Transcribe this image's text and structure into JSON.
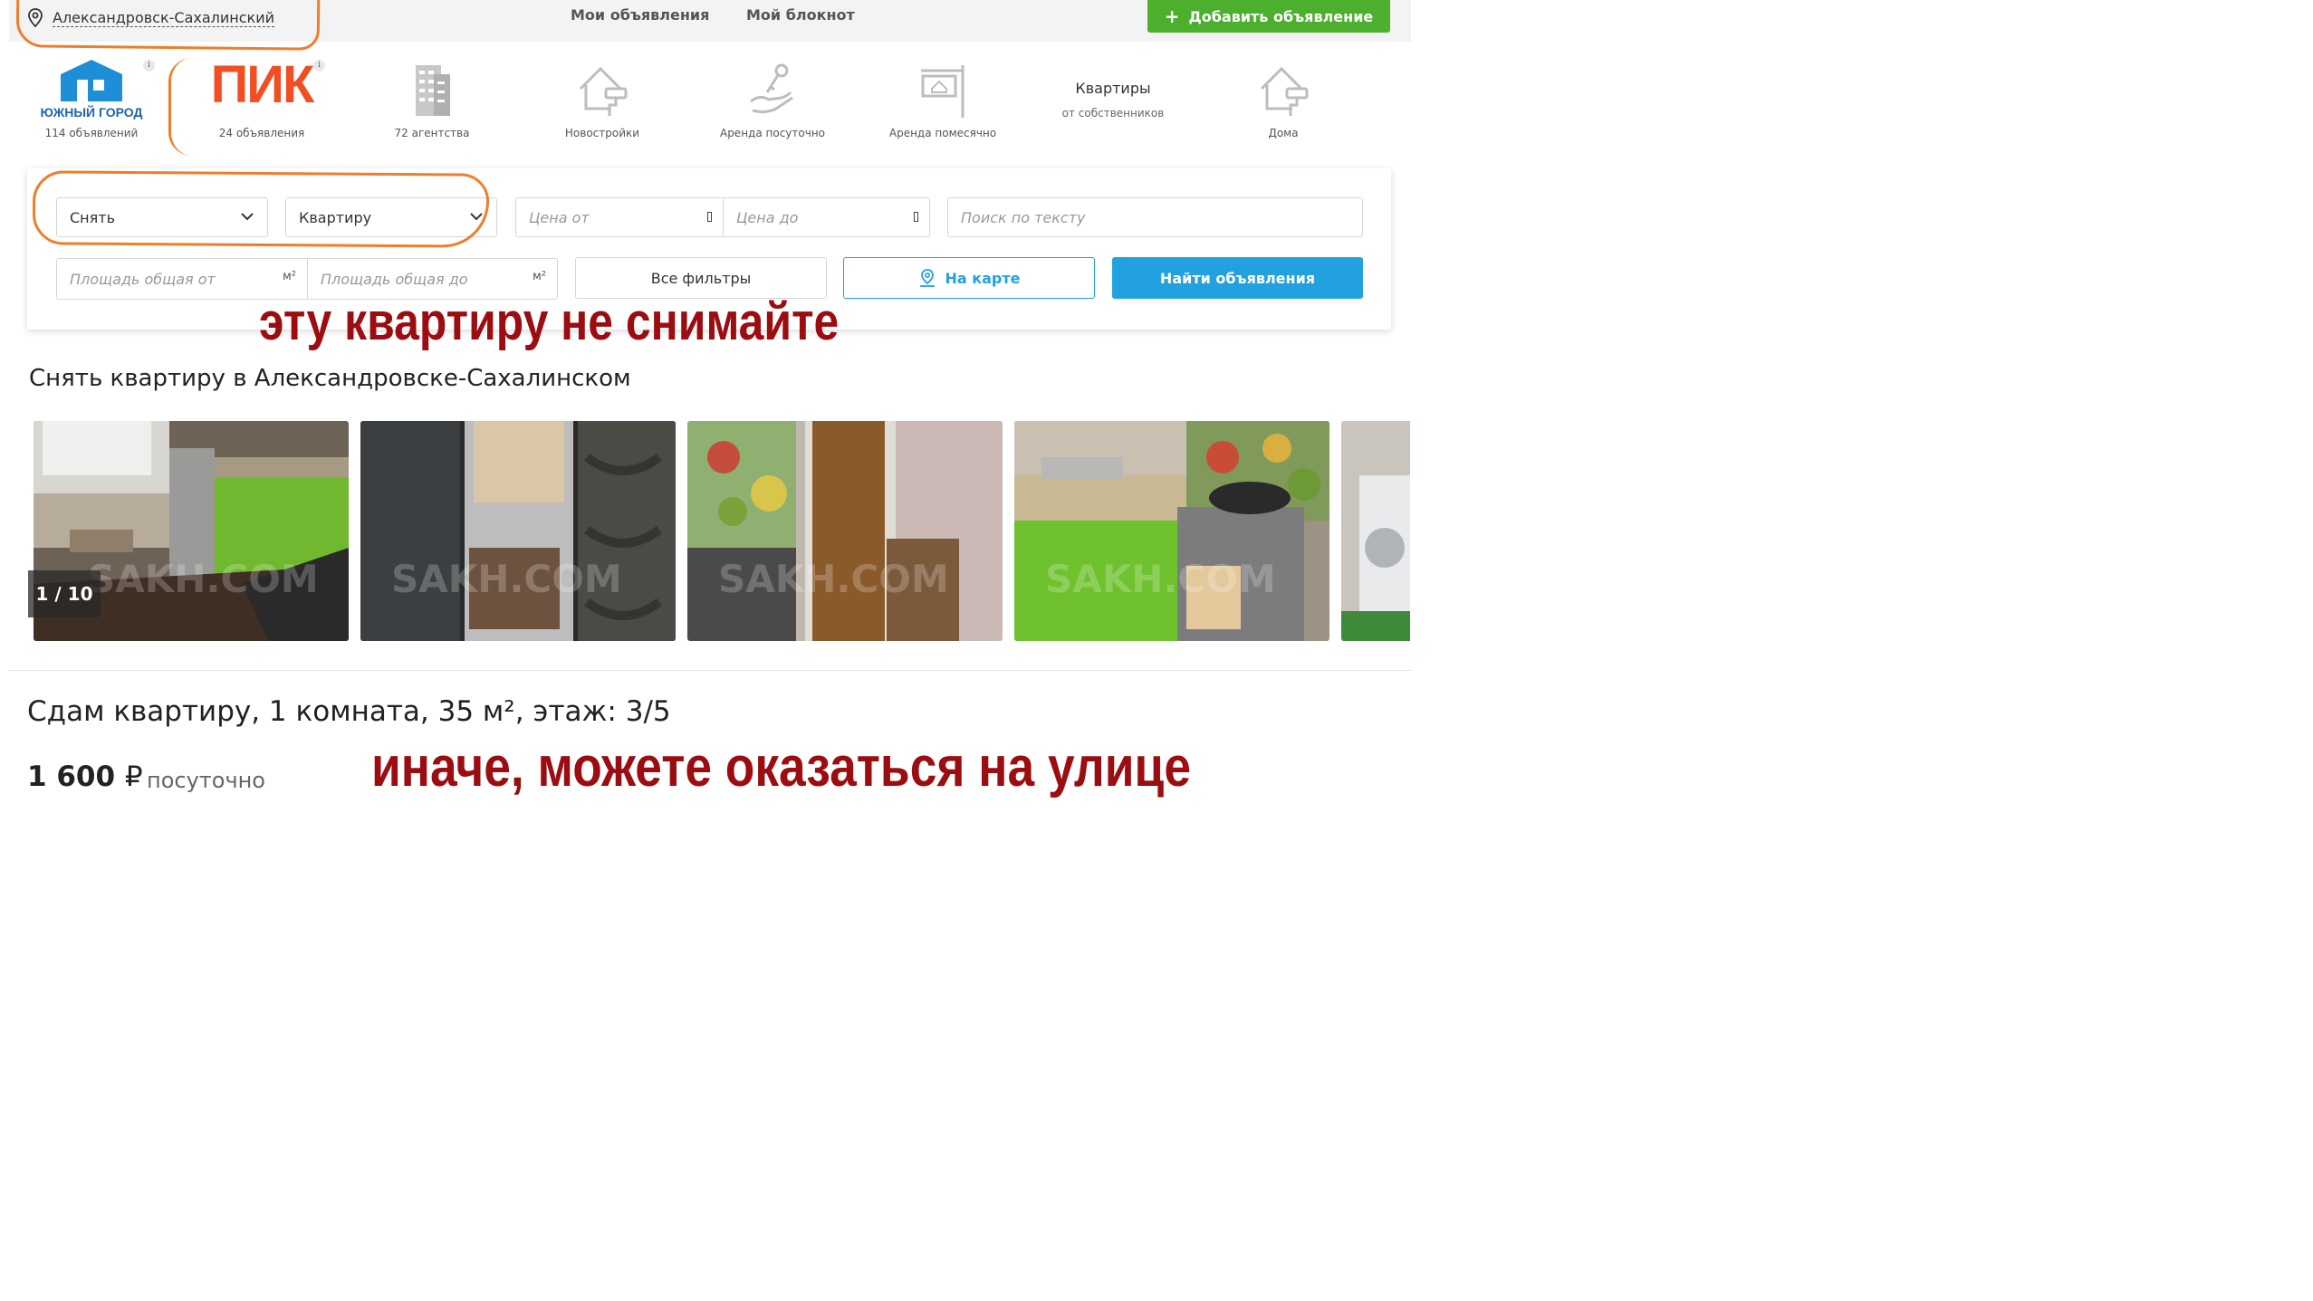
{
  "header": {
    "city": "Александровск-Сахалинский",
    "links": [
      "Мои объявления",
      "Мой блокнот"
    ],
    "add_button": "Добавить объявление",
    "add_plus": "+"
  },
  "categories": [
    {
      "logo": "ЮЖНЫЙ ГОРОД",
      "caption": "114 объявлений"
    },
    {
      "logo": "ПИК",
      "caption": "24 объявления"
    },
    {
      "caption": "72 агентства"
    },
    {
      "caption": "Новостройки"
    },
    {
      "caption": "Аренда посуточно"
    },
    {
      "caption": "Аренда помесячно"
    },
    {
      "title": "Квартиры",
      "caption": "от собственников"
    },
    {
      "caption": "Дома"
    }
  ],
  "info_mark": "i",
  "filters": {
    "deal": "Снять",
    "type": "Квартиру",
    "price_from": "Цена от",
    "price_to": "Цена до",
    "text_search": "Поиск по тексту",
    "area_from": "Площадь общая от",
    "area_to": "Площадь общая до",
    "area_unit": "м²",
    "all_filters": "Все фильтры",
    "on_map": "На карте",
    "find": "Найти объявления"
  },
  "overlay": {
    "top_caption": "эту квартиру не снимайте",
    "bottom_caption": "иначе, можете оказаться на улице"
  },
  "page_title": "Снять квартиру в Александровске-Сахалинском",
  "gallery": {
    "counter": "1 / 10",
    "watermark": "SAKH.COM"
  },
  "listing": {
    "title": "Сдам квартиру, 1 комната, 35 м², этаж: 3/5",
    "price": "1 600",
    "currency": "₽",
    "period": "посуточно"
  },
  "colors": {
    "accent_blue": "#21a1e0",
    "add_green": "#4caf2e",
    "caption_red": "#9b0d10",
    "circle_orange": "#f07d2a"
  }
}
